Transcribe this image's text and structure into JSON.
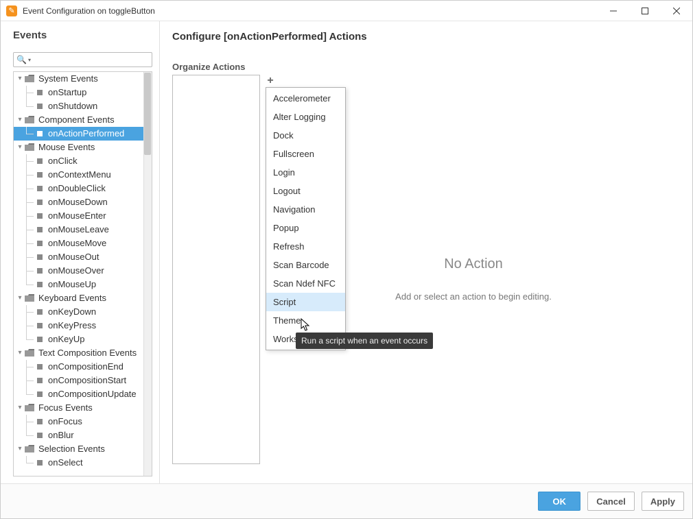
{
  "window": {
    "title": "Event Configuration on toggleButton"
  },
  "sidebar": {
    "title": "Events",
    "search_placeholder": "",
    "groups": [
      {
        "label": "System Events",
        "items": [
          "onStartup",
          "onShutdown"
        ]
      },
      {
        "label": "Component Events",
        "items": [
          "onActionPerformed"
        ],
        "selected_index": 0
      },
      {
        "label": "Mouse Events",
        "items": [
          "onClick",
          "onContextMenu",
          "onDoubleClick",
          "onMouseDown",
          "onMouseEnter",
          "onMouseLeave",
          "onMouseMove",
          "onMouseOut",
          "onMouseOver",
          "onMouseUp"
        ]
      },
      {
        "label": "Keyboard Events",
        "items": [
          "onKeyDown",
          "onKeyPress",
          "onKeyUp"
        ]
      },
      {
        "label": "Text Composition Events",
        "items": [
          "onCompositionEnd",
          "onCompositionStart",
          "onCompositionUpdate"
        ]
      },
      {
        "label": "Focus Events",
        "items": [
          "onFocus",
          "onBlur"
        ]
      },
      {
        "label": "Selection Events",
        "items": [
          "onSelect"
        ]
      }
    ],
    "selected_path": "Component Events > onActionPerformed"
  },
  "main": {
    "title": "Configure [onActionPerformed] Actions",
    "organize_label": "Organize Actions",
    "plus_label": "+",
    "dropdown_items": [
      "Accelerometer",
      "Alter Logging",
      "Dock",
      "Fullscreen",
      "Login",
      "Logout",
      "Navigation",
      "Popup",
      "Refresh",
      "Scan Barcode",
      "Scan Ndef NFC",
      "Script",
      "Theme",
      "Workstation Mode"
    ],
    "dropdown_hovered_index": 11,
    "tooltip": "Run a script when an event occurs",
    "no_action_title": "No Action",
    "no_action_hint": "Add or select an action to begin editing."
  },
  "footer": {
    "ok": "OK",
    "cancel": "Cancel",
    "apply": "Apply"
  }
}
